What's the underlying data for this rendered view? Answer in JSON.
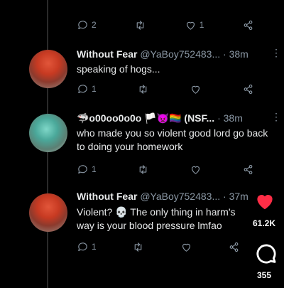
{
  "top_actions": {
    "replies": "2",
    "likes": "1"
  },
  "tweets": [
    {
      "name": "Without Fear",
      "handle": "@YaBoy752483...",
      "time": "· 38m",
      "text": "speaking of hogs...",
      "replies": "1",
      "likes": ""
    },
    {
      "name": "🦈o00oo0o0o 🏳️👿🏳️‍🌈 (NSF...",
      "handle": "",
      "time": "· 38m",
      "text": "who made you so violent good lord go back to doing your homework",
      "replies": "1",
      "likes": ""
    },
    {
      "name": "Without Fear",
      "handle": "@YaBoy752483...",
      "time": "· 37m",
      "text": "Violent? 💀 The only thing in harm's way is your blood pressure lmfao",
      "replies": "1",
      "likes": ""
    }
  ],
  "overlay": {
    "likes": "61.2K",
    "comments": "355"
  },
  "colors": {
    "heart": "#ff2d46",
    "muted": "#8b98a5"
  },
  "icons": [
    "reply-icon",
    "retweet-icon",
    "like-icon",
    "share-icon",
    "more-icon"
  ]
}
